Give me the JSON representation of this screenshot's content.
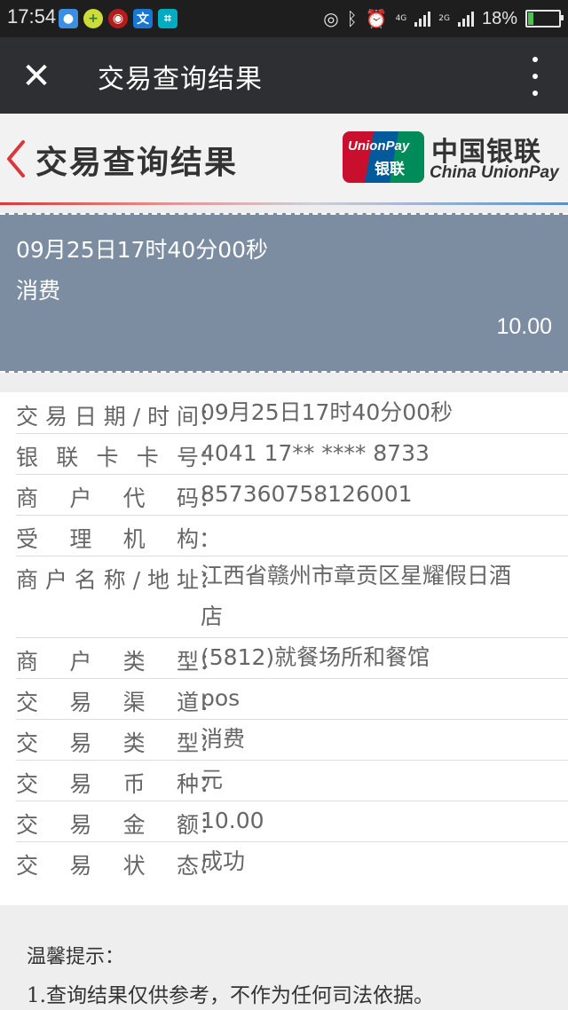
{
  "status_bar": {
    "time": "17:54",
    "net_top": "4G",
    "net_bottom": "2G",
    "battery_text": "18%",
    "battery_level": 0.18,
    "app_icons": [
      "wechat-icon",
      "add-app-icon",
      "weibo-icon",
      "translate-icon",
      "scanner-icon"
    ]
  },
  "appbar": {
    "title": "交易查询结果"
  },
  "page_header": {
    "title": "交易查询结果",
    "logo": {
      "card_text_1": "UnionPay",
      "card_text_2": "银联",
      "cn_name": "中国银联",
      "en_name": "China UnionPay"
    }
  },
  "summary": {
    "datetime": "09月25日17时40分00秒",
    "type": "消费",
    "amount": "10.00"
  },
  "details": [
    {
      "label": "交易日期/时间",
      "value": "09月25日17时40分00秒"
    },
    {
      "label": "银联卡卡号",
      "value": "4041 17** **** 8733"
    },
    {
      "label": "商户代码",
      "value": "857360758126001"
    },
    {
      "label": "受理机构",
      "value": ""
    },
    {
      "label": "商户名称/地址",
      "value": "江西省赣州市章贡区星耀假日酒店"
    },
    {
      "label": "商户类型",
      "value": "(5812)就餐场所和餐馆"
    },
    {
      "label": "交易渠道",
      "value": "pos"
    },
    {
      "label": "交易类型",
      "value": "消费"
    },
    {
      "label": "交易币种",
      "value": "元"
    },
    {
      "label": "交易金额",
      "value": "10.00"
    },
    {
      "label": "交易状态",
      "value": "成功"
    }
  ],
  "tips": {
    "title": "温馨提示：",
    "item_1": "1.查询结果仅供参考，不作为任何司法依据。"
  },
  "colors": {
    "status_bar_bg": "#1e1e1e",
    "appbar_bg": "#2e2f32",
    "summary_bg": "#7c8da2",
    "accent_red": "#d9383a",
    "unionpay_red": "#c8102e",
    "unionpay_blue": "#005a9c",
    "unionpay_green": "#008c5a"
  }
}
